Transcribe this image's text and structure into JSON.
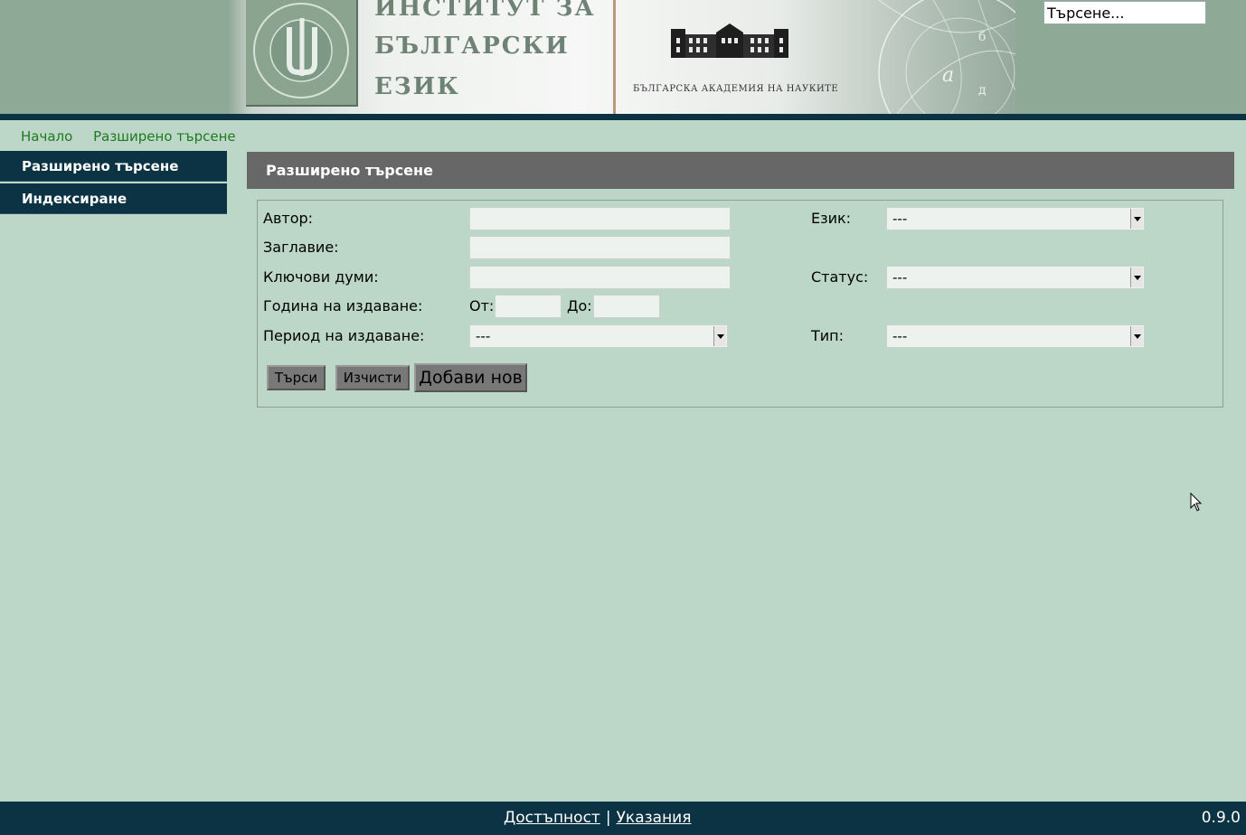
{
  "header": {
    "institute_lines": [
      "ИНСТИТУТ ЗА",
      "БЪЛГАРСКИ",
      "ЕЗИК"
    ],
    "academy": "БЪЛГАРСКА АКАДЕМИЯ НА НАУКИТЕ",
    "search_placeholder": "Търсене..."
  },
  "breadcrumb": [
    "Начало",
    "Разширено търсене"
  ],
  "sidebar": {
    "items": [
      {
        "label": "Разширено търсене"
      },
      {
        "label": "Индексиране"
      }
    ]
  },
  "main": {
    "title": "Разширено търсене",
    "form": {
      "author_label": "Автор:",
      "title_label": "Заглавие:",
      "keywords_label": "Ключови думи:",
      "year_label": "Година на издаване:",
      "year_from_label": "От:",
      "year_to_label": "До:",
      "period_label": "Период на издаване:",
      "period_value": "---",
      "language_label": "Език:",
      "language_value": "---",
      "status_label": "Статус:",
      "status_value": "---",
      "type_label": "Тип:",
      "type_value": "---",
      "search_button": "Търси",
      "clear_button": "Изчисти",
      "add_new_button": "Добави нов"
    }
  },
  "footer": {
    "accessibility": "Достъпност",
    "separator": "|",
    "instructions": "Указания",
    "version": "0.9.0"
  },
  "colors": {
    "page_bg": "#bcd7c8",
    "nav_dark": "#0b3344",
    "panel_header": "#676767",
    "breadcrumb_link": "#1f7a1f"
  }
}
